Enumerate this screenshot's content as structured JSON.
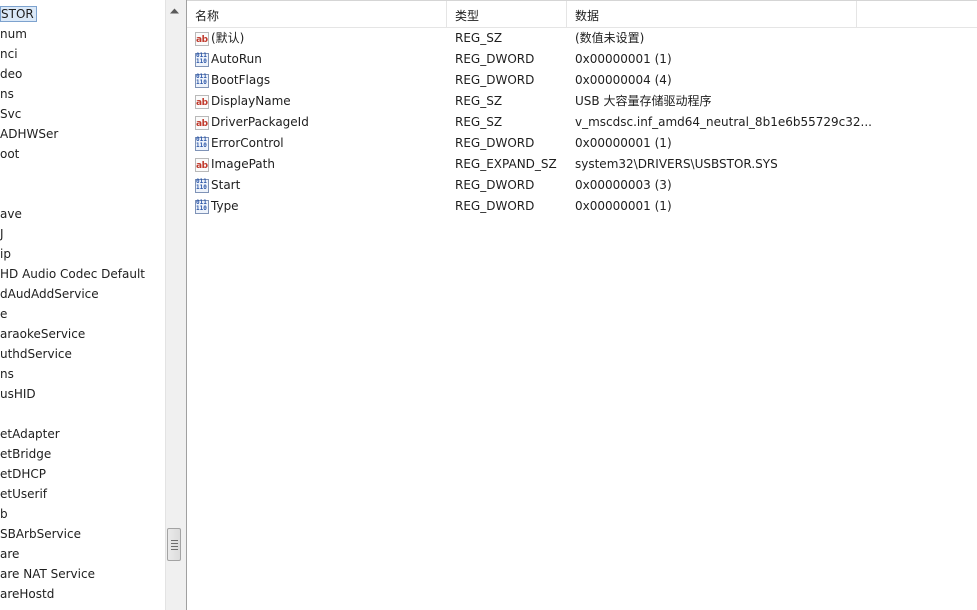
{
  "tree": {
    "items": [
      {
        "label": "STOR",
        "selected": true
      },
      {
        "label": "num"
      },
      {
        "label": "nci"
      },
      {
        "label": "deo"
      },
      {
        "label": "ns"
      },
      {
        "label": "Svc"
      },
      {
        "label": "ADHWSer"
      },
      {
        "label": "oot"
      },
      {
        "label": ""
      },
      {
        "label": ""
      },
      {
        "label": "ave"
      },
      {
        "label": "J"
      },
      {
        "label": "ip"
      },
      {
        "label": "HD Audio Codec Default"
      },
      {
        "label": "dAudAddService"
      },
      {
        "label": "e"
      },
      {
        "label": "araokeService"
      },
      {
        "label": "uthdService"
      },
      {
        "label": "ns"
      },
      {
        "label": "usHID"
      },
      {
        "label": ""
      },
      {
        "label": "etAdapter"
      },
      {
        "label": "etBridge"
      },
      {
        "label": "etDHCP"
      },
      {
        "label": "etUserif"
      },
      {
        "label": "b"
      },
      {
        "label": "SBArbService"
      },
      {
        "label": "are"
      },
      {
        "label": "are NAT Service"
      },
      {
        "label": "areHostd"
      }
    ]
  },
  "list": {
    "headers": {
      "name": "名称",
      "type": "类型",
      "data": "数据"
    },
    "rows": [
      {
        "icon": "string-value-icon",
        "name": "(默认)",
        "type": "REG_SZ",
        "data": "(数值未设置)"
      },
      {
        "icon": "binary-value-icon",
        "name": "AutoRun",
        "type": "REG_DWORD",
        "data": "0x00000001 (1)"
      },
      {
        "icon": "binary-value-icon",
        "name": "BootFlags",
        "type": "REG_DWORD",
        "data": "0x00000004 (4)"
      },
      {
        "icon": "string-value-icon",
        "name": "DisplayName",
        "type": "REG_SZ",
        "data": "USB 大容量存储驱动程序"
      },
      {
        "icon": "string-value-icon",
        "name": "DriverPackageId",
        "type": "REG_SZ",
        "data": "v_mscdsc.inf_amd64_neutral_8b1e6b55729c32..."
      },
      {
        "icon": "binary-value-icon",
        "name": "ErrorControl",
        "type": "REG_DWORD",
        "data": "0x00000001 (1)"
      },
      {
        "icon": "string-value-icon",
        "name": "ImagePath",
        "type": "REG_EXPAND_SZ",
        "data": "system32\\DRIVERS\\USBSTOR.SYS"
      },
      {
        "icon": "binary-value-icon",
        "name": "Start",
        "type": "REG_DWORD",
        "data": "0x00000003 (3)"
      },
      {
        "icon": "binary-value-icon",
        "name": "Type",
        "type": "REG_DWORD",
        "data": "0x00000001 (1)"
      }
    ]
  },
  "colors": {
    "selection_bg": "#dbe9f8",
    "selection_border": "#7da2ce"
  }
}
